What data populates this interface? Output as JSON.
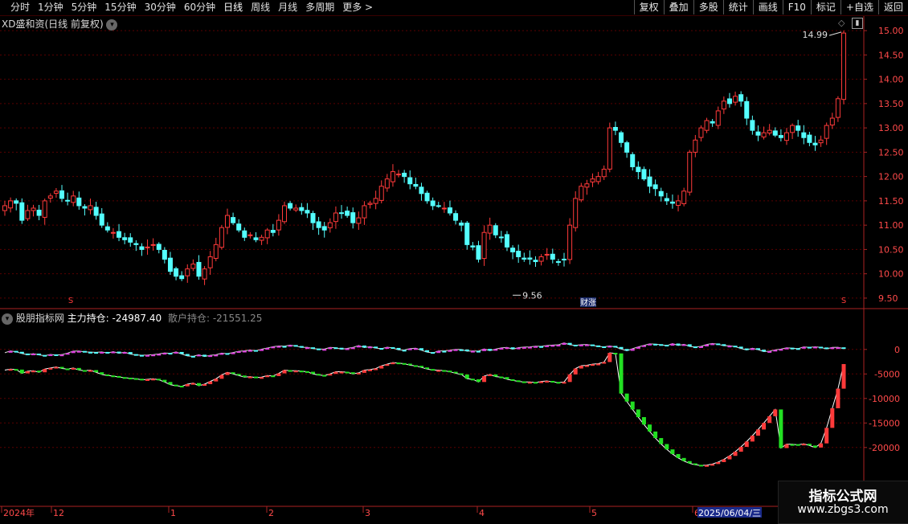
{
  "toolbar": {
    "periods": [
      "分时",
      "1分钟",
      "5分钟",
      "15分钟",
      "30分钟",
      "60分钟",
      "日线",
      "周线",
      "月线",
      "多周期",
      "更多 >"
    ],
    "active_period": "日线",
    "actions": [
      "复权",
      "叠加",
      "多股",
      "统计",
      "画线",
      "F10",
      "标记",
      "+自选",
      "返回"
    ]
  },
  "main_panel": {
    "title": "XD盛和资(日线 前复权)",
    "high_label": "14.99",
    "low_label": "9.56",
    "event_marker": "财涨",
    "s_markers": [
      "S",
      "S"
    ]
  },
  "sub_panel": {
    "indicator": "股朋指标网",
    "main_label": "主力持仓:",
    "main_value": "-24987.40",
    "retail_label": "散户持仓:",
    "retail_value": "-21551.25"
  },
  "x_axis": {
    "labels": [
      "2024年",
      "12",
      "1",
      "2",
      "3",
      "4",
      "5",
      "6"
    ],
    "cursor_date": "2025/06/04/三"
  },
  "watermark": {
    "line1": "指标公式网",
    "line2": "www.zbgs3.com"
  },
  "colors": {
    "up": "#ff3a3a",
    "down": "#54ffff",
    "magenta": "#e040e0",
    "green": "#22e022",
    "grid": "#5a0000",
    "axis": "#aa2222"
  },
  "chart_data": {
    "type": "candlestick",
    "price_axis": {
      "ticks": [
        9.5,
        10.0,
        10.5,
        11.0,
        11.5,
        12.0,
        12.5,
        13.0,
        13.5,
        14.0,
        14.5,
        15.0
      ],
      "ylim": [
        9.35,
        15.2
      ]
    },
    "indicator_axis": {
      "ticks": [
        0,
        -5000,
        -10000,
        -15000,
        -20000
      ],
      "ylim": [
        -32000,
        8000
      ]
    },
    "close": [
      11.4,
      11.5,
      11.45,
      11.1,
      11.3,
      11.35,
      11.2,
      11.5,
      11.6,
      11.7,
      11.55,
      11.5,
      11.6,
      11.4,
      11.35,
      11.4,
      11.2,
      11.0,
      10.9,
      10.85,
      10.75,
      10.7,
      10.65,
      10.6,
      10.5,
      10.55,
      10.6,
      10.5,
      10.3,
      10.05,
      9.95,
      9.9,
      10.1,
      10.2,
      9.95,
      10.1,
      10.35,
      10.6,
      10.95,
      11.2,
      11.05,
      10.9,
      10.75,
      10.8,
      10.7,
      10.75,
      10.9,
      10.85,
      11.1,
      11.4,
      11.35,
      11.35,
      11.3,
      11.25,
      11.05,
      10.95,
      10.9,
      11.05,
      11.25,
      11.25,
      11.2,
      11.05,
      11.15,
      11.4,
      11.45,
      11.55,
      11.8,
      11.95,
      12.1,
      12.05,
      12.0,
      11.85,
      11.8,
      11.65,
      11.5,
      11.4,
      11.4,
      11.35,
      11.25,
      11.1,
      11.0,
      10.6,
      10.55,
      10.3,
      10.85,
      11.0,
      10.8,
      10.75,
      10.55,
      10.45,
      10.35,
      10.3,
      10.3,
      10.25,
      10.35,
      10.4,
      10.3,
      10.25,
      10.3,
      11.0,
      11.55,
      11.8,
      11.85,
      11.95,
      12.0,
      12.15,
      13.0,
      12.95,
      12.7,
      12.5,
      12.2,
      12.1,
      11.95,
      11.8,
      11.75,
      11.6,
      11.5,
      11.45,
      11.5,
      11.7,
      12.5,
      12.75,
      13.0,
      13.15,
      13.1,
      13.35,
      13.55,
      13.5,
      13.65,
      13.55,
      13.2,
      12.95,
      12.85,
      12.9,
      12.95,
      12.85,
      12.8,
      12.9,
      13.05,
      12.95,
      12.8,
      12.7,
      12.65,
      12.75,
      13.05,
      13.2,
      13.6,
      14.95
    ],
    "main_holding_last": -24987.4,
    "retail_holding_last": -21551.25
  }
}
